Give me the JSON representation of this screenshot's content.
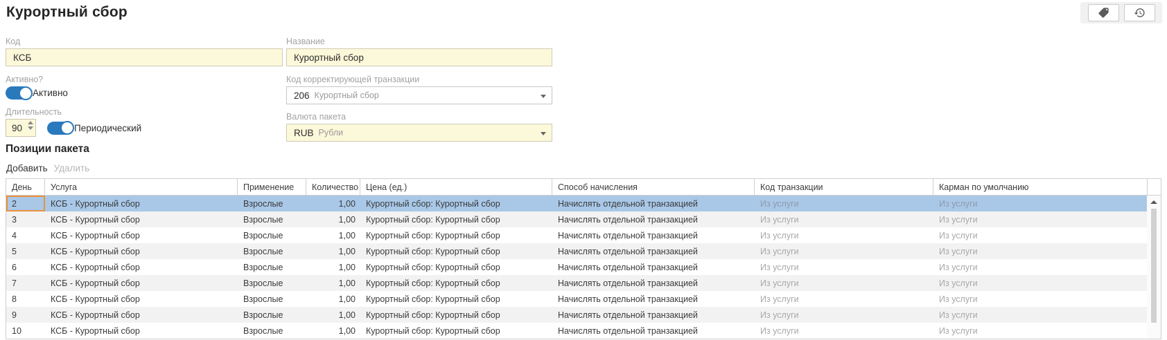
{
  "page": {
    "title": "Курортный сбор"
  },
  "toolbar": {
    "tags_button": {
      "icon": "tag-icon"
    },
    "history_button": {
      "icon": "history-icon"
    }
  },
  "form": {
    "code": {
      "label": "Код",
      "value": "КСБ"
    },
    "name": {
      "label": "Название",
      "value": "Курортный сбор"
    },
    "active": {
      "label": "Активно?",
      "toggle_label": "Активно",
      "state": "on"
    },
    "correction_code": {
      "label": "Код корректирующей транзакции",
      "value": "206",
      "secondary": "Курортный сбор"
    },
    "duration": {
      "label": "Длительность",
      "value": "90",
      "toggle_label": "Периодический",
      "state": "on"
    },
    "currency": {
      "label": "Валюта пакета",
      "value": "RUB",
      "secondary": "Рубли"
    }
  },
  "positions": {
    "heading": "Позиции пакета",
    "add_label": "Добавить",
    "delete_label": "Удалить",
    "table": {
      "columns": [
        "День",
        "Услуга",
        "Применение",
        "Количество",
        "Цена (ед.)",
        "Способ начисления",
        "Код транзакции",
        "Карман по умолчанию"
      ],
      "selected_day": "2",
      "rows": [
        {
          "day": "2",
          "service": "КСБ - Курортный сбор",
          "application": "Взрослые",
          "quantity": "1,00",
          "price": "Курортный сбор: Курортный сбор",
          "accrual": "Начислять отдельной транзакцией",
          "transaction_code": "Из услуги",
          "pocket": "Из услуги"
        },
        {
          "day": "3",
          "service": "КСБ - Курортный сбор",
          "application": "Взрослые",
          "quantity": "1,00",
          "price": "Курортный сбор: Курортный сбор",
          "accrual": "Начислять отдельной транзакцией",
          "transaction_code": "Из услуги",
          "pocket": "Из услуги"
        },
        {
          "day": "4",
          "service": "КСБ - Курортный сбор",
          "application": "Взрослые",
          "quantity": "1,00",
          "price": "Курортный сбор: Курортный сбор",
          "accrual": "Начислять отдельной транзакцией",
          "transaction_code": "Из услуги",
          "pocket": "Из услуги"
        },
        {
          "day": "5",
          "service": "КСБ - Курортный сбор",
          "application": "Взрослые",
          "quantity": "1,00",
          "price": "Курортный сбор: Курортный сбор",
          "accrual": "Начислять отдельной транзакцией",
          "transaction_code": "Из услуги",
          "pocket": "Из услуги"
        },
        {
          "day": "6",
          "service": "КСБ - Курортный сбор",
          "application": "Взрослые",
          "quantity": "1,00",
          "price": "Курортный сбор: Курортный сбор",
          "accrual": "Начислять отдельной транзакцией",
          "transaction_code": "Из услуги",
          "pocket": "Из услуги"
        },
        {
          "day": "7",
          "service": "КСБ - Курортный сбор",
          "application": "Взрослые",
          "quantity": "1,00",
          "price": "Курортный сбор: Курортный сбор",
          "accrual": "Начислять отдельной транзакцией",
          "transaction_code": "Из услуги",
          "pocket": "Из услуги"
        },
        {
          "day": "8",
          "service": "КСБ - Курортный сбор",
          "application": "Взрослые",
          "quantity": "1,00",
          "price": "Курортный сбор: Курортный сбор",
          "accrual": "Начислять отдельной транзакцией",
          "transaction_code": "Из услуги",
          "pocket": "Из услуги"
        },
        {
          "day": "9",
          "service": "КСБ - Курортный сбор",
          "application": "Взрослые",
          "quantity": "1,00",
          "price": "Курортный сбор: Курортный сбор",
          "accrual": "Начислять отдельной транзакцией",
          "transaction_code": "Из услуги",
          "pocket": "Из услуги"
        },
        {
          "day": "10",
          "service": "КСБ - Курортный сбор",
          "application": "Взрослые",
          "quantity": "1,00",
          "price": "Курортный сбор: Курортный сбор",
          "accrual": "Начислять отдельной транзакцией",
          "transaction_code": "Из услуги",
          "pocket": "Из услуги"
        }
      ]
    }
  },
  "colors": {
    "accent_blue": "#2a79bd",
    "selected_row": "#a9c8e8",
    "focus_outline": "#e8923c",
    "input_yellow": "#fcf8da",
    "alt_row": "#f2f2f2",
    "muted_text": "#a8a8a8"
  }
}
